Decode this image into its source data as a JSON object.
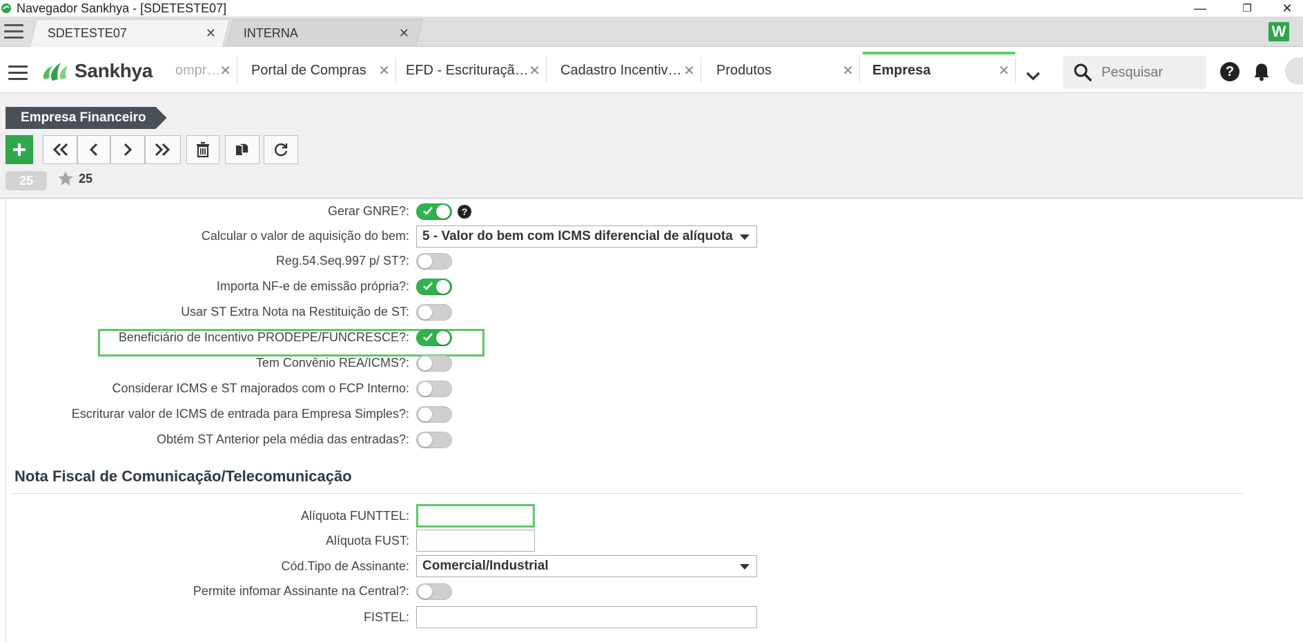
{
  "window": {
    "title": "Navegador Sankhya - [SDETESTE07]",
    "controls": [
      "—",
      "❐",
      "✕"
    ]
  },
  "browser_tabs": [
    {
      "label": "SDETESTE07",
      "close": "✕",
      "active": true
    },
    {
      "label": "INTERNA",
      "close": "✕",
      "active": false
    }
  ],
  "brand": {
    "name": "Sankhya",
    "logo_letter": "W"
  },
  "app_tabs": [
    {
      "label": "ompr…",
      "close": "✕"
    },
    {
      "label": "Portal de Compras",
      "close": "✕"
    },
    {
      "label": "EFD - Escrituraçã…",
      "close": "✕"
    },
    {
      "label": "Cadastro Incentiv…",
      "close": "✕"
    },
    {
      "label": "Produtos",
      "close": "✕"
    },
    {
      "label": "Empresa",
      "close": "✕"
    }
  ],
  "search": {
    "placeholder": "Pesquisar"
  },
  "help_label": "?",
  "breadcrumb": "Empresa Financeiro",
  "record": {
    "counter": "25",
    "favorite_count": "25"
  },
  "fields": [
    {
      "label": "Gerar GNRE?:",
      "type": "toggle",
      "on": true,
      "help": "?"
    },
    {
      "label": "Calcular o valor de aquisição do bem:",
      "type": "select",
      "value": "5 - Valor do bem com ICMS diferencial de alíquota"
    },
    {
      "label": "Reg.54.Seq.997 p/ ST?:",
      "type": "toggle",
      "on": false
    },
    {
      "label": "Importa NF-e de emissão própria?:",
      "type": "toggle",
      "on": true
    },
    {
      "label": "Usar ST Extra Nota na Restituição de ST:",
      "type": "toggle",
      "on": false
    },
    {
      "label": "Beneficiário de Incentivo PRODEPE/FUNCRESCE?:",
      "type": "toggle",
      "on": true
    },
    {
      "label": "Tem Convênio REA/ICMS?:",
      "type": "toggle",
      "on": false
    },
    {
      "label": "Considerar ICMS e ST majorados com o FCP Interno:",
      "type": "toggle",
      "on": false
    },
    {
      "label": "Escriturar valor de ICMS de entrada para Empresa Simples?:",
      "type": "toggle",
      "on": false
    },
    {
      "label": "Obtém ST Anterior pela média das entradas?:",
      "type": "toggle",
      "on": false
    }
  ],
  "section": {
    "title": "Nota Fiscal de Comunicação/Telecomunicação",
    "fields": [
      {
        "label": "Alíquota FUNTTEL:",
        "type": "text",
        "value": ""
      },
      {
        "label": "Alíquota FUST:",
        "type": "text",
        "value": ""
      },
      {
        "label": "Cód.Tipo de Assinante:",
        "type": "select",
        "value": "Comercial/Industrial"
      },
      {
        "label": "Permite infomar Assinante na Central?:",
        "type": "toggle",
        "on": false
      },
      {
        "label": "FISTEL:",
        "type": "text",
        "value": ""
      }
    ]
  },
  "colors": {
    "accent": "#2fb34a",
    "highlight": "#5bc86a",
    "breadcrumb_bg": "#4a5058"
  }
}
